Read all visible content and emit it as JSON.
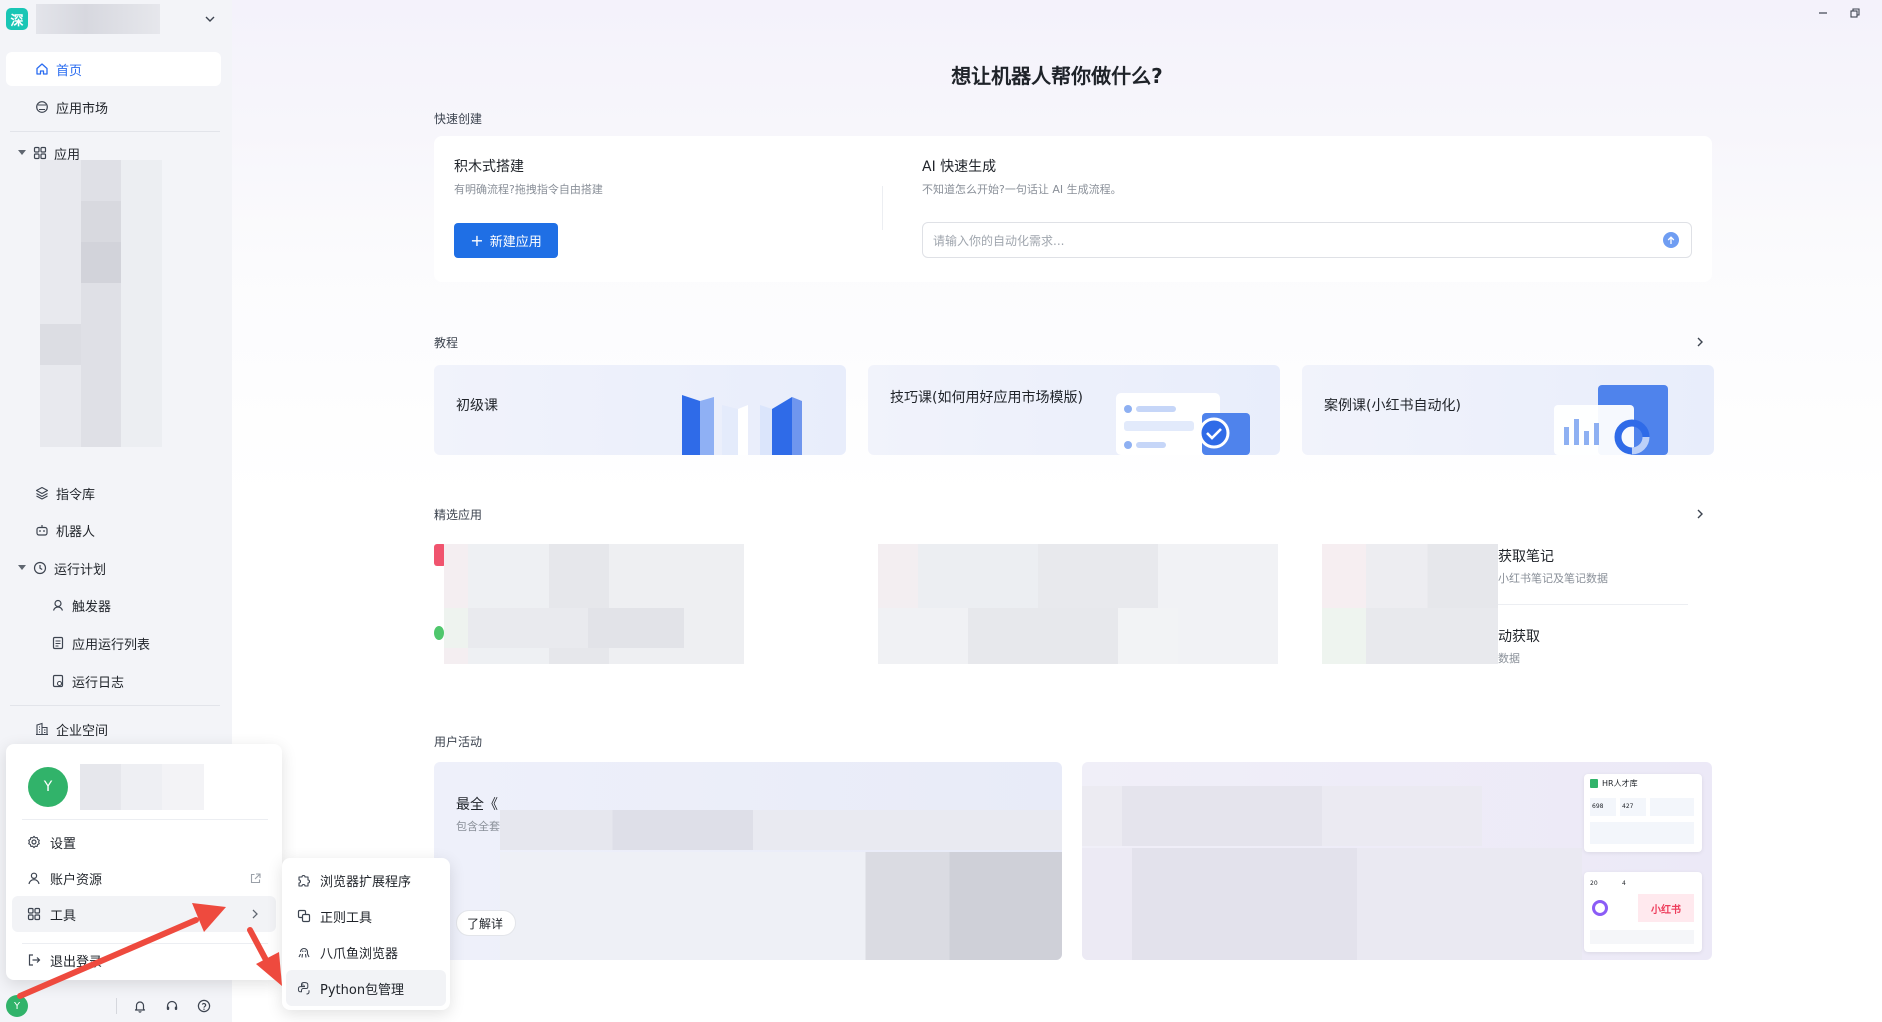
{
  "sidebar": {
    "logo_char": "深",
    "nav": {
      "home": "首页",
      "market": "应用市场",
      "apps": "应用",
      "commands": "指令库",
      "robots": "机器人",
      "run_plan": "运行计划",
      "triggers": "触发器",
      "app_run_list": "应用运行列表",
      "run_log": "运行日志",
      "enterprise": "企业空间"
    },
    "avatar_initial": "Y"
  },
  "account_menu": {
    "avatar_initial": "Y",
    "settings": "设置",
    "account_resources": "账户资源",
    "tools": "工具",
    "logout": "退出登录"
  },
  "tools_menu": {
    "items": [
      "浏览器扩展程序",
      "正则工具",
      "八爪鱼浏览器",
      "Python包管理"
    ]
  },
  "main": {
    "hero_title": "想让机器人帮你做什么?",
    "quick_create": {
      "section_label": "快速创建",
      "block_title": "积木式搭建",
      "block_sub": "有明确流程?拖拽指令自由搭建",
      "new_app_button": "新建应用",
      "ai_title": "AI 快速生成",
      "ai_sub": "不知道怎么开始?一句话让 AI 生成流程。",
      "ai_placeholder": "请输入你的自动化需求..."
    },
    "tutorials": {
      "section_label": "教程",
      "cards": [
        "初级课",
        "技巧课(如何用好应用市场模版)",
        "案例课(小红书自动化)"
      ]
    },
    "featured": {
      "section_label": "精选应用",
      "item1_title": "获取笔记",
      "item1_sub": "小红书笔记及笔记数据",
      "item2_title": "动获取",
      "item2_sub": "数据"
    },
    "activities": {
      "section_label": "用户活动",
      "card_title": "最全《",
      "card_sub": "包含全套",
      "learn_button": "了解详",
      "thumb1_label": "HR人才库",
      "thumb1_n1": "698",
      "thumb1_n2": "427",
      "thumb2_label": "小红书",
      "thumb2_n1": "20",
      "thumb2_n2": "4"
    }
  },
  "colors": {
    "accent": "#1f6fe5",
    "annotation": "#ee4a3e",
    "avatar": "#31b36a",
    "logo": "#19c6b5"
  }
}
